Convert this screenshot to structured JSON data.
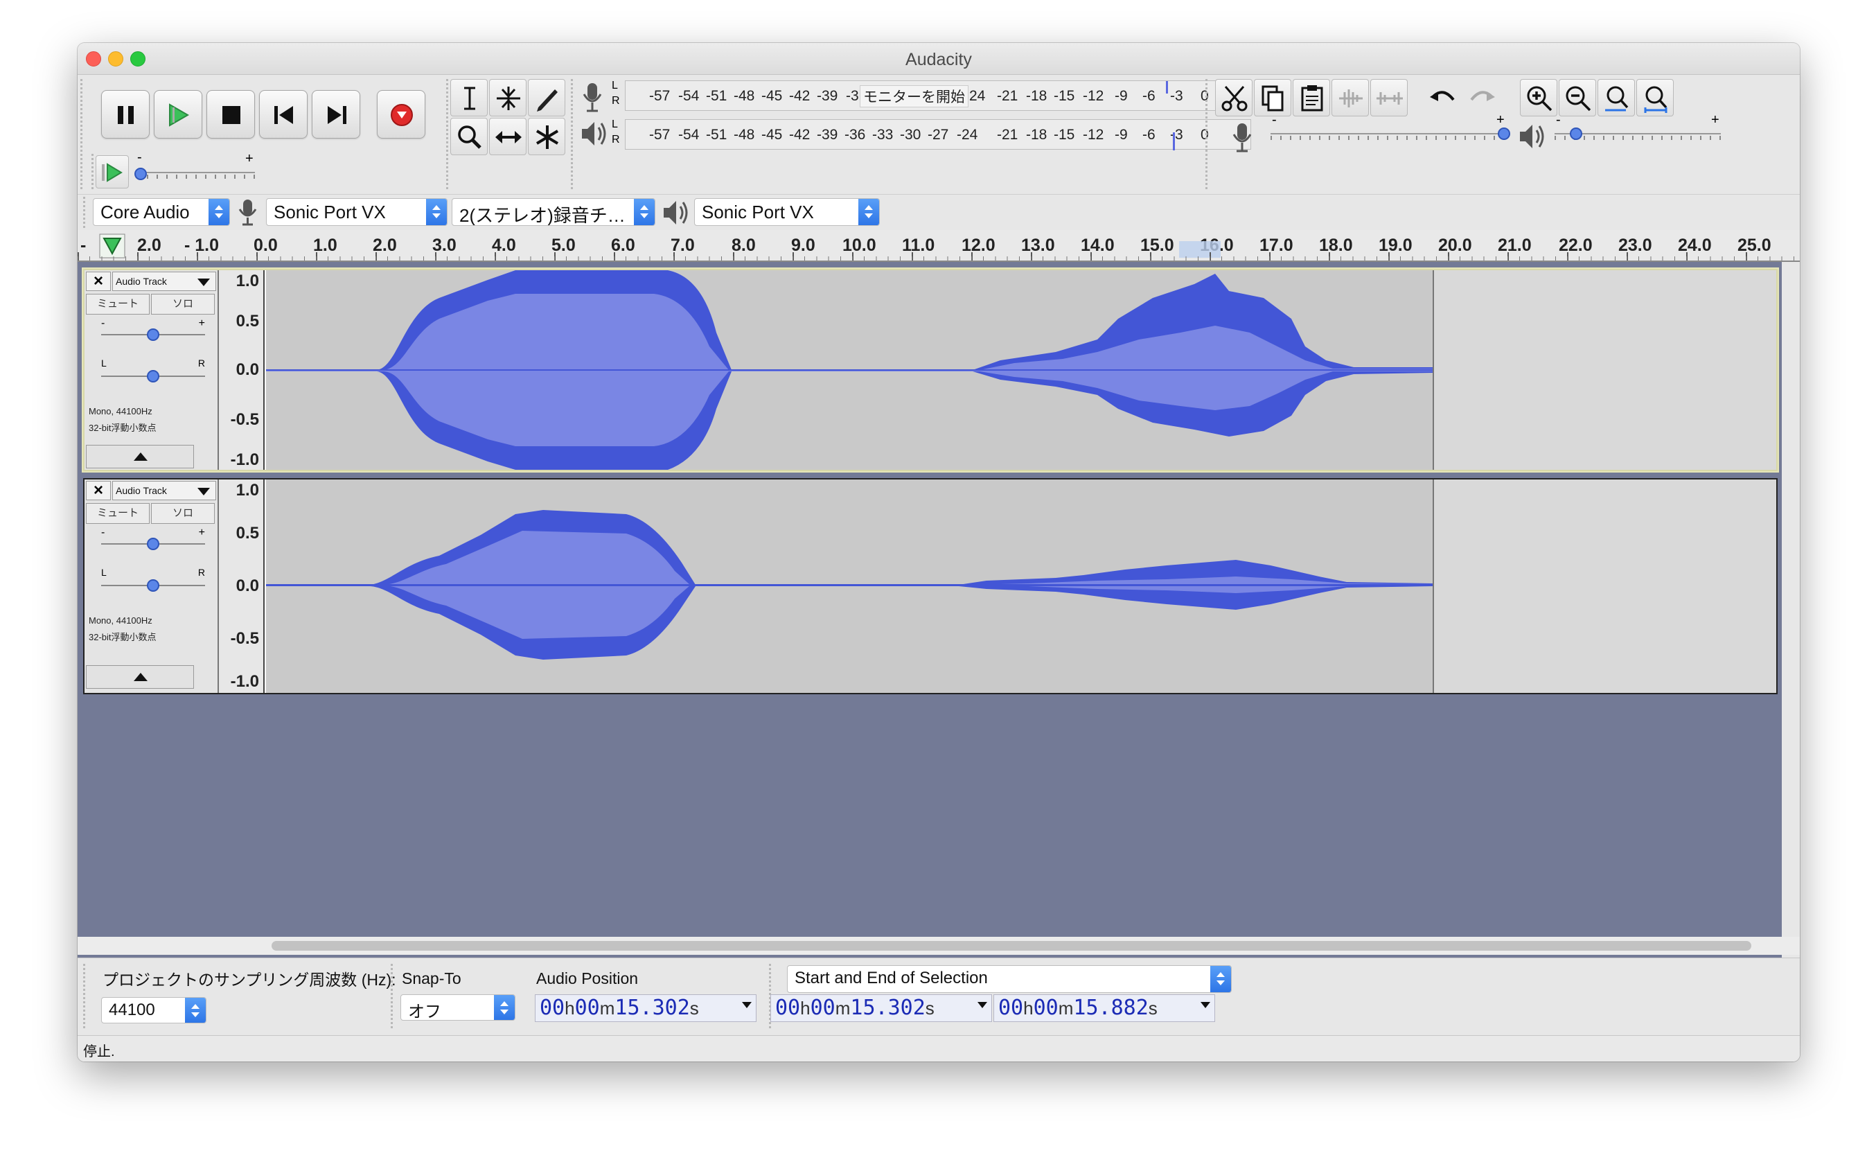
{
  "window": {
    "title": "Audacity"
  },
  "transport": {
    "buttons": [
      "pause-icon",
      "play-icon",
      "stop-icon",
      "skip-to-start-icon",
      "skip-to-end-icon",
      "record-icon"
    ]
  },
  "meters": {
    "record_ticks": [
      "L",
      "R",
      "-57",
      "-54",
      "-51",
      "-48",
      "-45",
      "-42",
      "-39",
      "-3",
      "モニターを開始",
      "24",
      "-21",
      "-18",
      "-15",
      "-12",
      "-9",
      "-6",
      "-3",
      "0"
    ],
    "record_message": "モニターを開始",
    "play_ticks": [
      "L",
      "R",
      "-57",
      "-54",
      "-51",
      "-48",
      "-45",
      "-42",
      "-39",
      "-36",
      "-33",
      "-30",
      "-27",
      "-24",
      "-21",
      "-18",
      "-15",
      "-12",
      "-9",
      "-6",
      "-3",
      "0"
    ],
    "minus": "-",
    "plus": "+"
  },
  "device": {
    "host": "Core Audio",
    "recording_device": "Sonic Port VX",
    "channels": "2(ステレオ)録音チ…",
    "playback_device": "Sonic Port VX"
  },
  "ruler": {
    "labels": [
      "-",
      "2.0",
      "- 1.0",
      "0.0",
      "1.0",
      "2.0",
      "3.0",
      "4.0",
      "5.0",
      "6.0",
      "7.0",
      "8.0",
      "9.0",
      "10.0",
      "11.0",
      "12.0",
      "13.0",
      "14.0",
      "15.0",
      "16.0",
      "17.0",
      "18.0",
      "19.0",
      "20.0",
      "21.0",
      "22.0",
      "23.0",
      "24.0",
      "25.0"
    ]
  },
  "tracks": [
    {
      "name": "Audio Track",
      "mute": "ミュート",
      "solo": "ソロ",
      "gain_minus": "-",
      "gain_plus": "+",
      "pan_left": "L",
      "pan_right": "R",
      "rate": "Mono, 44100Hz",
      "format": "32-bit浮動小数点",
      "scale": [
        "1.0",
        "0.5",
        "0.0",
        "-0.5",
        "-1.0"
      ]
    },
    {
      "name": "Audio Track",
      "mute": "ミュート",
      "solo": "ソロ",
      "gain_minus": "-",
      "gain_plus": "+",
      "pan_left": "L",
      "pan_right": "R",
      "rate": "Mono, 44100Hz",
      "format": "32-bit浮動小数点",
      "scale": [
        "1.0",
        "0.5",
        "0.0",
        "-0.5",
        "-1.0"
      ]
    }
  ],
  "selection_bar": {
    "rate_label": "プロジェクトのサンプリング周波数 (Hz):",
    "rate_value": "44100",
    "snap_label": "Snap-To",
    "snap_value": "オフ",
    "position_label": "Audio Position",
    "selection_mode": "Start and End of Selection",
    "audio_position": [
      "00",
      "h",
      "00",
      "m",
      "15.302",
      "s"
    ],
    "selection_start": [
      "00",
      "h",
      "00",
      "m",
      "15.302",
      "s"
    ],
    "selection_end": [
      "00",
      "h",
      "00",
      "m",
      "15.882",
      "s"
    ]
  },
  "status": {
    "text": "停止."
  },
  "colors": {
    "wave_dark": "#4356d6",
    "wave_light": "#7a86e4",
    "track_bg": "#737a96",
    "record": "#e02b2b"
  }
}
